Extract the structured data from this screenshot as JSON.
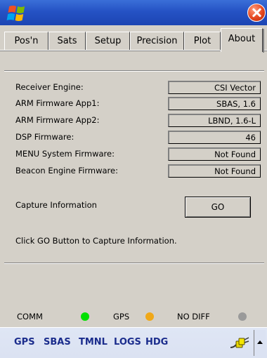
{
  "tabs": [
    {
      "label": "Pos'n"
    },
    {
      "label": "Sats"
    },
    {
      "label": "Setup"
    },
    {
      "label": "Precision"
    },
    {
      "label": "Plot"
    },
    {
      "label": "About",
      "active": true
    }
  ],
  "firmware": [
    {
      "label": "Receiver Engine:",
      "value": "CSI Vector"
    },
    {
      "label": "ARM Firmware App1:",
      "value": "SBAS, 1.6"
    },
    {
      "label": "ARM Firmware App2:",
      "value": "LBND, 1.6-L"
    },
    {
      "label": "DSP Firmware:",
      "value": "46"
    },
    {
      "label": "MENU System Firmware:",
      "value": "Not Found"
    },
    {
      "label": "Beacon Engine Firmware:",
      "value": "Not Found"
    }
  ],
  "capture": {
    "label": "Capture Information",
    "button": "GO",
    "note": "Click GO Button to Capture Information."
  },
  "status": {
    "comm": {
      "label": "COMM",
      "color": "#00e000"
    },
    "gps": {
      "label": "GPS",
      "color": "#f0a818"
    },
    "diff": {
      "label": "NO DIFF",
      "color": "#9a9a9a"
    }
  },
  "commands": [
    "GPS",
    "SBAS",
    "TMNL",
    "LOGS",
    "HDG"
  ],
  "icons": {
    "start": "windows-flag-icon",
    "close": "close-icon",
    "plug": "plug-icon",
    "sip": "chevron-up-icon"
  }
}
